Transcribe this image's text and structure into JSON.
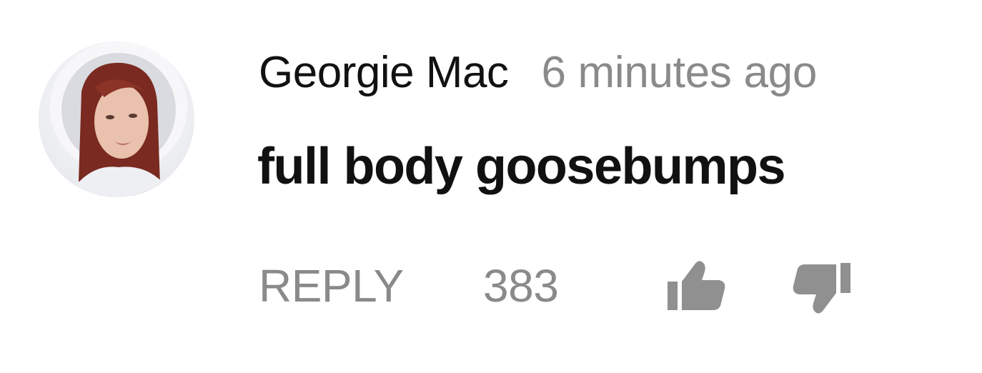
{
  "comment": {
    "author": "Georgie Mac",
    "timestamp": "6 minutes ago",
    "text": "full body goosebumps",
    "avatar_icon": "user-avatar",
    "actions": {
      "reply_label": "REPLY",
      "like_count": "383",
      "like_icon": "thumbs-up-icon",
      "dislike_icon": "thumbs-down-icon"
    }
  },
  "colors": {
    "primary_text": "#111111",
    "secondary_text": "#8a8a8a",
    "icon": "#909090",
    "background": "#ffffff"
  }
}
